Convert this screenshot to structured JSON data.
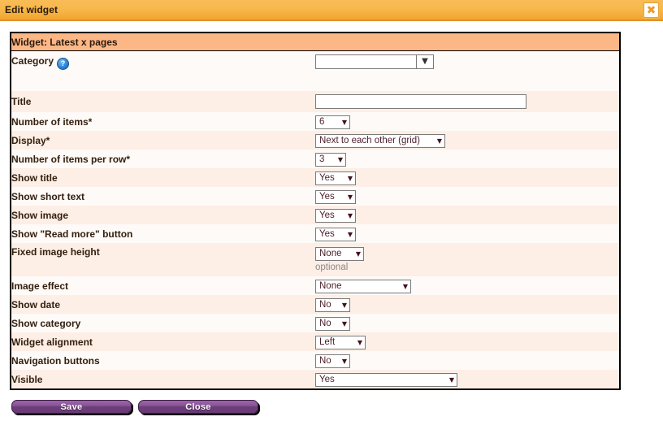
{
  "window": {
    "title": "Edit widget",
    "close_label": "✖",
    "close_icon": "close-icon"
  },
  "panel": {
    "header": "Widget: Latest x pages"
  },
  "fields": [
    {
      "label": "Category",
      "has_help": true,
      "help_glyph": "?",
      "control": "combo",
      "value": "",
      "caret": "▼"
    },
    {
      "label": "Title",
      "control": "text",
      "value": "",
      "placeholder": ""
    },
    {
      "label": "Number of items*",
      "control": "select",
      "value": "6",
      "caret": "▼"
    },
    {
      "label": "Display*",
      "control": "select",
      "value": "Next to each other (grid)",
      "caret": "▼"
    },
    {
      "label": "Number of items per row*",
      "control": "select",
      "value": "3",
      "caret": "▼"
    },
    {
      "label": "Show title",
      "control": "select",
      "value": "Yes",
      "caret": "▼"
    },
    {
      "label": "Show short text",
      "control": "select",
      "value": "Yes",
      "caret": "▼"
    },
    {
      "label": "Show image",
      "control": "select",
      "value": "Yes",
      "caret": "▼"
    },
    {
      "label": "Show \"Read more\" button",
      "control": "select",
      "value": "Yes",
      "caret": "▼"
    },
    {
      "label": "Fixed image height",
      "control": "select",
      "value": "None",
      "hint": "optional",
      "caret": "▼"
    },
    {
      "label": "Image effect",
      "control": "select",
      "value": "None",
      "caret": "▼"
    },
    {
      "label": "Show date",
      "control": "select",
      "value": "No",
      "caret": "▼"
    },
    {
      "label": "Show category",
      "control": "select",
      "value": "No",
      "caret": "▼"
    },
    {
      "label": "Widget alignment",
      "control": "select",
      "value": "Left",
      "caret": "▼"
    },
    {
      "label": "Navigation buttons",
      "control": "select",
      "value": "No",
      "caret": "▼"
    },
    {
      "label": "Visible",
      "control": "select",
      "value": "Yes",
      "caret": "▼"
    }
  ],
  "actions": {
    "save_label": "Save",
    "close_label": "Close"
  },
  "colors": {
    "titlebar_top": "#f8bd57",
    "titlebar_bottom": "#f1a52f",
    "panel_header": "#fcb787",
    "row_alt": "#fdeee6",
    "row_plain": "#fefaf7",
    "button_purple": "#8b5599",
    "label_text": "#33200f",
    "select_text": "#4a1f28",
    "hint_text": "#8a8a8a",
    "help_blue": "#2f86d8"
  }
}
